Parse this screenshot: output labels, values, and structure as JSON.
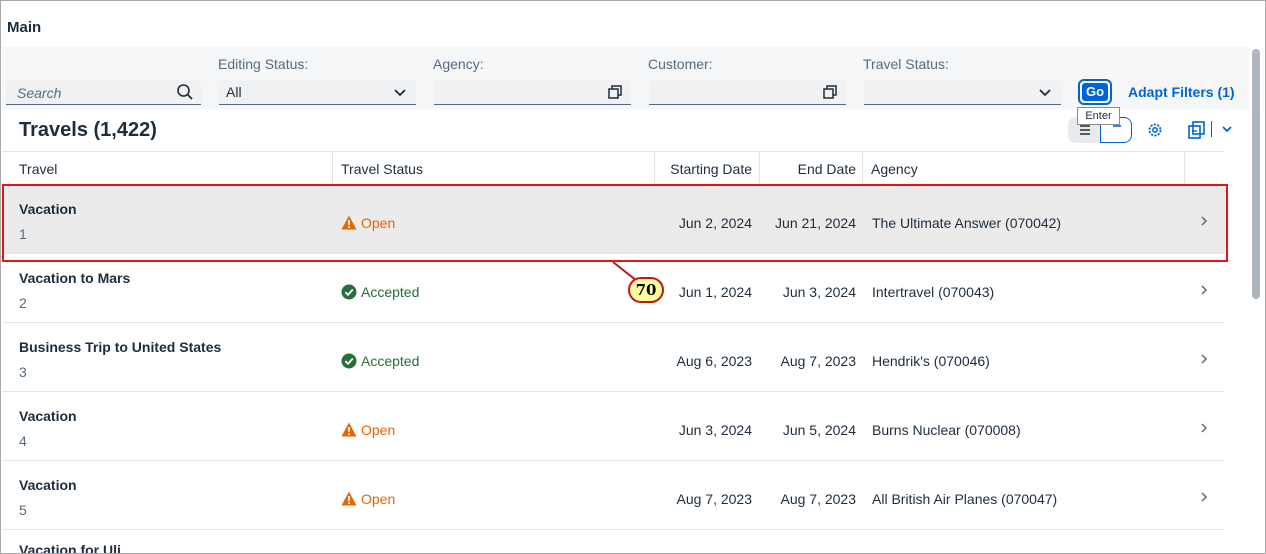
{
  "header": {
    "title": "Main"
  },
  "filters": {
    "search": {
      "placeholder": "Search",
      "icon": "search-icon"
    },
    "editing_status": {
      "label": "Editing Status:",
      "value": "All"
    },
    "agency": {
      "label": "Agency:",
      "value": ""
    },
    "customer": {
      "label": "Customer:",
      "value": ""
    },
    "travel_status": {
      "label": "Travel Status:",
      "value": ""
    },
    "go_label": "Go",
    "go_tooltip": "Enter",
    "adapt_filters_label": "Adapt Filters (1)"
  },
  "table": {
    "title": "Travels (1,422)",
    "columns": [
      "Travel",
      "Travel Status",
      "Starting Date",
      "End Date",
      "Agency"
    ],
    "rows": [
      {
        "name": "Vacation",
        "id": "1",
        "status": "Open",
        "status_kind": "warning",
        "start": "Jun 2, 2024",
        "end": "Jun 21, 2024",
        "agency": "The Ultimate Answer (070042)"
      },
      {
        "name": "Vacation to Mars",
        "id": "2",
        "status": "Accepted",
        "status_kind": "success",
        "start": "Jun 1, 2024",
        "end": "Jun 3, 2024",
        "agency": "Intertravel (070043)"
      },
      {
        "name": "Business Trip to United States",
        "id": "3",
        "status": "Accepted",
        "status_kind": "success",
        "start": "Aug 6, 2023",
        "end": "Aug 7, 2023",
        "agency": "Hendrik's (070046)"
      },
      {
        "name": "Vacation",
        "id": "4",
        "status": "Open",
        "status_kind": "warning",
        "start": "Jun 3, 2024",
        "end": "Jun 5, 2024",
        "agency": "Burns Nuclear (070008)"
      },
      {
        "name": "Vacation",
        "id": "5",
        "status": "Open",
        "status_kind": "warning",
        "start": "Aug 7, 2023",
        "end": "Aug 7, 2023",
        "agency": "All British Air Planes (070047)"
      }
    ],
    "partial_row_name": "Vacation for Uli"
  },
  "annotation": {
    "badge": "70"
  },
  "colors": {
    "accent": "#0064d9",
    "open": "#e76500",
    "accepted": "#256f3a",
    "highlight": "#e0161e",
    "badge_fill": "#ffffa0"
  }
}
